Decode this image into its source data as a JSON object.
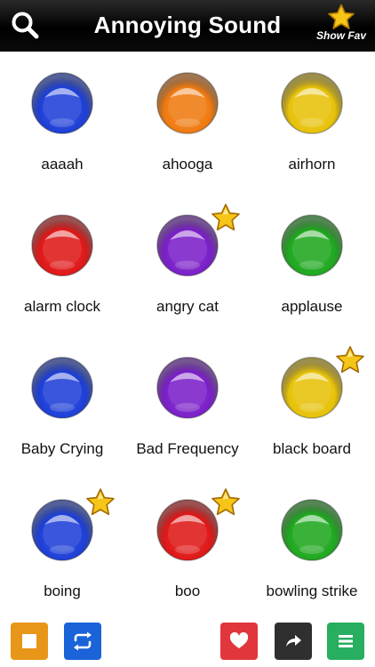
{
  "header": {
    "title": "Annoying Sound",
    "show_fav_label": "Show Fav",
    "search_icon": "search-icon",
    "star_icon": "star-icon"
  },
  "colors": {
    "blue": "#1e3fd8",
    "orange": "#f07a10",
    "yellow": "#e7c20a",
    "red": "#e01818",
    "purple": "#7a1fc9",
    "green": "#1fa81f",
    "star": "#f5c518"
  },
  "sounds": [
    {
      "label": "aaaah",
      "color": "blue",
      "favorite": false
    },
    {
      "label": "ahooga",
      "color": "orange",
      "favorite": false
    },
    {
      "label": "airhorn",
      "color": "yellow",
      "favorite": false
    },
    {
      "label": "alarm clock",
      "color": "red",
      "favorite": false
    },
    {
      "label": "angry cat",
      "color": "purple",
      "favorite": true
    },
    {
      "label": "applause",
      "color": "green",
      "favorite": false
    },
    {
      "label": "Baby Crying",
      "color": "blue",
      "favorite": false
    },
    {
      "label": "Bad Frequency",
      "color": "purple",
      "favorite": false
    },
    {
      "label": "black board",
      "color": "yellow",
      "favorite": true
    },
    {
      "label": "boing",
      "color": "blue",
      "favorite": true
    },
    {
      "label": "boo",
      "color": "red",
      "favorite": true
    },
    {
      "label": "bowling strike",
      "color": "green",
      "favorite": false
    }
  ],
  "toolbar": {
    "stop": {
      "icon": "stop-icon",
      "color": "#e8961a"
    },
    "repeat": {
      "icon": "repeat-icon",
      "color": "#1a63d8"
    },
    "favorite": {
      "icon": "heart-icon",
      "color": "#e0363c"
    },
    "share": {
      "icon": "share-arrow-icon",
      "color": "#2f2f2f"
    },
    "menu": {
      "icon": "menu-icon",
      "color": "#27ae60"
    }
  }
}
